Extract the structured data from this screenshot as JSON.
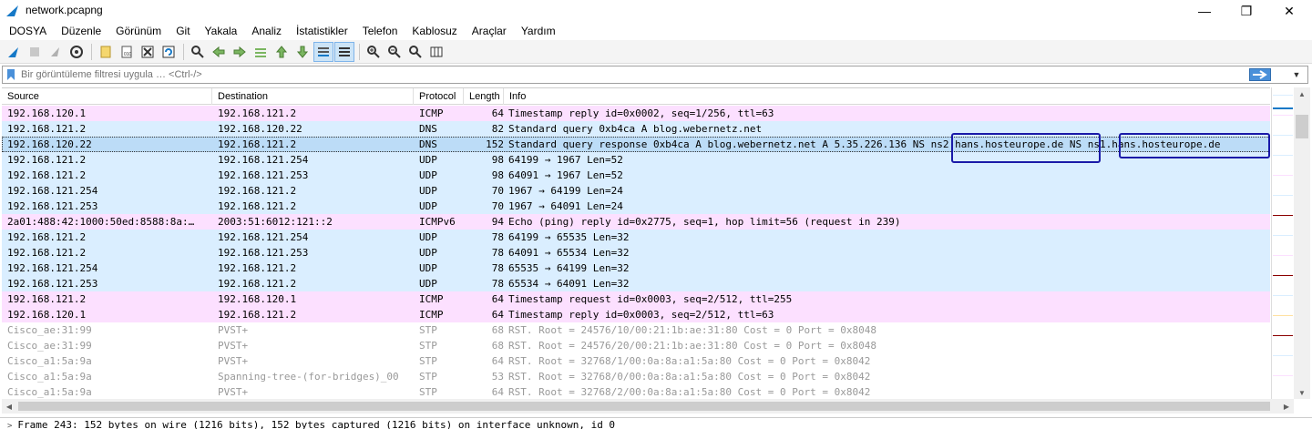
{
  "window": {
    "title": "network.pcapng",
    "minimize": "—",
    "restore": "❐",
    "close": "✕"
  },
  "menu": [
    "DOSYA",
    "Düzenle",
    "Görünüm",
    "Git",
    "Yakala",
    "Analiz",
    "İstatistikler",
    "Telefon",
    "Kablosuz",
    "Araçlar",
    "Yardım"
  ],
  "toolbar": {
    "icons": [
      "shark-fin-start-icon",
      "stop-capture-icon",
      "restart-capture-icon",
      "capture-options-icon",
      "open-file-icon",
      "save-file-icon",
      "close-file-icon",
      "reload-file-icon",
      "find-packet-icon",
      "go-back-icon",
      "go-forward-icon",
      "go-to-packet-icon",
      "first-packet-icon",
      "last-packet-icon",
      "autoscroll-icon",
      "colorize-icon",
      "zoom-in-icon",
      "zoom-out-icon",
      "zoom-reset-icon",
      "resize-columns-icon"
    ]
  },
  "filter": {
    "placeholder": "Bir görüntüleme filtresi uygula … <Ctrl-/>"
  },
  "columns": {
    "source": "Source",
    "destination": "Destination",
    "protocol": "Protocol",
    "length": "Length",
    "info": "Info"
  },
  "colors": {
    "icmp": "#fce0ff",
    "udp": "#daeeff",
    "selected": "#bcdcf7",
    "stp": "#ffffff",
    "stp_text": "#999999",
    "annotation": "#1a1aa8"
  },
  "rows": [
    {
      "source": "192.168.120.1",
      "destination": "192.168.121.2",
      "protocol": "ICMP",
      "length": "64",
      "info": "Timestamp reply      id=0x0002, seq=1/256, ttl=63",
      "kind": "icmp"
    },
    {
      "source": "192.168.121.2",
      "destination": "192.168.120.22",
      "protocol": "DNS",
      "length": "82",
      "info": "Standard query 0xb4ca A blog.webernetz.net",
      "kind": "udp"
    },
    {
      "source": "192.168.120.22",
      "destination": "192.168.121.2",
      "protocol": "DNS",
      "length": "152",
      "info": "Standard query response 0xb4ca A blog.webernetz.net A 5.35.226.136 NS ns2.hans.hosteurope.de NS ns1.hans.hosteurope.de",
      "kind": "selected"
    },
    {
      "source": "192.168.121.2",
      "destination": "192.168.121.254",
      "protocol": "UDP",
      "length": "98",
      "info": "64199 → 1967 Len=52",
      "kind": "udp"
    },
    {
      "source": "192.168.121.2",
      "destination": "192.168.121.253",
      "protocol": "UDP",
      "length": "98",
      "info": "64091 → 1967 Len=52",
      "kind": "udp"
    },
    {
      "source": "192.168.121.254",
      "destination": "192.168.121.2",
      "protocol": "UDP",
      "length": "70",
      "info": "1967 → 64199 Len=24",
      "kind": "udp"
    },
    {
      "source": "192.168.121.253",
      "destination": "192.168.121.2",
      "protocol": "UDP",
      "length": "70",
      "info": "1967 → 64091 Len=24",
      "kind": "udp"
    },
    {
      "source": "2a01:488:42:1000:50ed:8588:8a:…",
      "destination": "2003:51:6012:121::2",
      "protocol": "ICMPv6",
      "length": "94",
      "info": "Echo (ping) reply id=0x2775, seq=1, hop limit=56 (request in 239)",
      "kind": "icmp"
    },
    {
      "source": "192.168.121.2",
      "destination": "192.168.121.254",
      "protocol": "UDP",
      "length": "78",
      "info": "64199 → 65535 Len=32",
      "kind": "udp"
    },
    {
      "source": "192.168.121.2",
      "destination": "192.168.121.253",
      "protocol": "UDP",
      "length": "78",
      "info": "64091 → 65534 Len=32",
      "kind": "udp"
    },
    {
      "source": "192.168.121.254",
      "destination": "192.168.121.2",
      "protocol": "UDP",
      "length": "78",
      "info": "65535 → 64199 Len=32",
      "kind": "udp"
    },
    {
      "source": "192.168.121.253",
      "destination": "192.168.121.2",
      "protocol": "UDP",
      "length": "78",
      "info": "65534 → 64091 Len=32",
      "kind": "udp"
    },
    {
      "source": "192.168.121.2",
      "destination": "192.168.120.1",
      "protocol": "ICMP",
      "length": "64",
      "info": "Timestamp request    id=0x0003, seq=2/512, ttl=255",
      "kind": "icmp"
    },
    {
      "source": "192.168.120.1",
      "destination": "192.168.121.2",
      "protocol": "ICMP",
      "length": "64",
      "info": "Timestamp reply      id=0x0003, seq=2/512, ttl=63",
      "kind": "icmp"
    },
    {
      "source": "Cisco_ae:31:99",
      "destination": "PVST+",
      "protocol": "STP",
      "length": "68",
      "info": "RST. Root = 24576/10/00:21:1b:ae:31:80  Cost = 0  Port = 0x8048",
      "kind": "stp"
    },
    {
      "source": "Cisco_ae:31:99",
      "destination": "PVST+",
      "protocol": "STP",
      "length": "68",
      "info": "RST. Root = 24576/20/00:21:1b:ae:31:80  Cost = 0  Port = 0x8048",
      "kind": "stp"
    },
    {
      "source": "Cisco_a1:5a:9a",
      "destination": "PVST+",
      "protocol": "STP",
      "length": "64",
      "info": "RST. Root = 32768/1/00:0a:8a:a1:5a:80  Cost = 0  Port = 0x8042",
      "kind": "stp"
    },
    {
      "source": "Cisco_a1:5a:9a",
      "destination": "Spanning-tree-(for-bridges)_00",
      "protocol": "STP",
      "length": "53",
      "info": "RST. Root = 32768/0/00:0a:8a:a1:5a:80  Cost = 0  Port = 0x8042",
      "kind": "stp"
    },
    {
      "source": "Cisco_a1:5a:9a",
      "destination": "PVST+",
      "protocol": "STP",
      "length": "64",
      "info": "RST. Root = 32768/2/00:0a:8a:a1:5a:80  Cost = 0  Port = 0x8042",
      "kind": "stp"
    }
  ],
  "detail": {
    "expander": ">",
    "line": "Frame 243: 152 bytes on wire (1216 bits), 152 bytes captured (1216 bits) on interface unknown, id 0"
  }
}
